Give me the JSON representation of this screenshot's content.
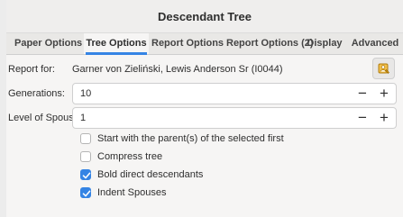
{
  "window": {
    "title": "Descendant Tree"
  },
  "tabs": [
    {
      "label": "Paper Options",
      "active": false
    },
    {
      "label": "Tree Options",
      "active": true
    },
    {
      "label": "Report Options",
      "active": false
    },
    {
      "label": "Report Options (2)",
      "active": false
    },
    {
      "label": "Display",
      "active": false
    },
    {
      "label": "Advanced",
      "active": false
    }
  ],
  "form": {
    "report_for": {
      "label": "Report for:",
      "value": "Garner von Zieliński, Lewis Anderson Sr (I0044)",
      "button_icon": "person-select-icon"
    },
    "generations": {
      "label": "Generations:",
      "value": "10"
    },
    "level_of_spouses": {
      "label": "Level of Spouses:",
      "value": "1"
    },
    "spin_minus": "−",
    "spin_plus": "+",
    "checkboxes": [
      {
        "label": "Start with the parent(s) of the selected first",
        "checked": false
      },
      {
        "label": "Compress tree",
        "checked": false
      },
      {
        "label": "Bold direct descendants",
        "checked": true
      },
      {
        "label": "Indent Spouses",
        "checked": true
      }
    ]
  },
  "colors": {
    "accent": "#3584e4",
    "icon_orange": "#e5a50a"
  }
}
